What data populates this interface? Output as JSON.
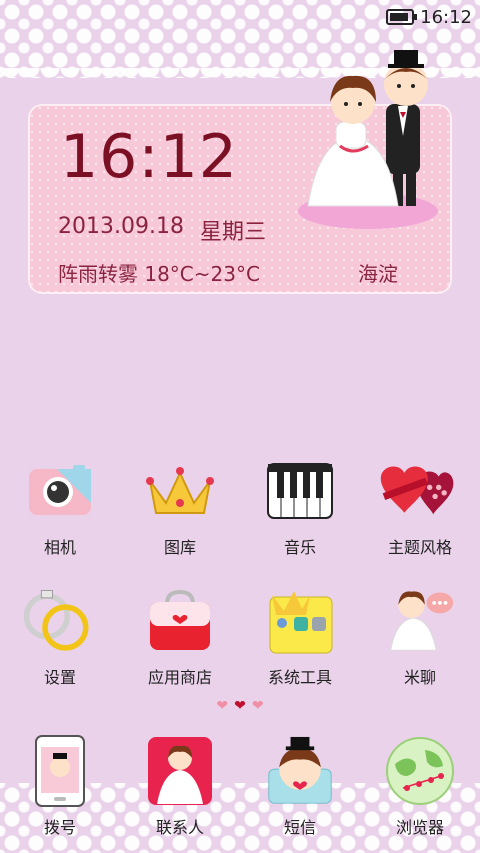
{
  "status_bar": {
    "time": "16:12",
    "battery_icon": "battery-icon"
  },
  "widget": {
    "time": "16:12",
    "date": "2013.09.18",
    "weekday": "星期三",
    "weather": "阵雨转雾  18°C~23°C",
    "district": "海淀"
  },
  "apps": [
    {
      "label": "相机",
      "icon": "camera-icon"
    },
    {
      "label": "图库",
      "icon": "crown-icon"
    },
    {
      "label": "音乐",
      "icon": "piano-icon"
    },
    {
      "label": "主题风格",
      "icon": "hearts-icon"
    },
    {
      "label": "设置",
      "icon": "rings-icon"
    },
    {
      "label": "应用商店",
      "icon": "bag-icon"
    },
    {
      "label": "系统工具",
      "icon": "tools-folder-icon"
    },
    {
      "label": "米聊",
      "icon": "bride-chat-icon"
    }
  ],
  "page_indicator": {
    "count": 3,
    "active_index": 1
  },
  "dock": [
    {
      "label": "拨号",
      "icon": "phone-icon"
    },
    {
      "label": "联系人",
      "icon": "contacts-icon"
    },
    {
      "label": "短信",
      "icon": "sms-icon"
    },
    {
      "label": "浏览器",
      "icon": "globe-icon"
    }
  ]
}
